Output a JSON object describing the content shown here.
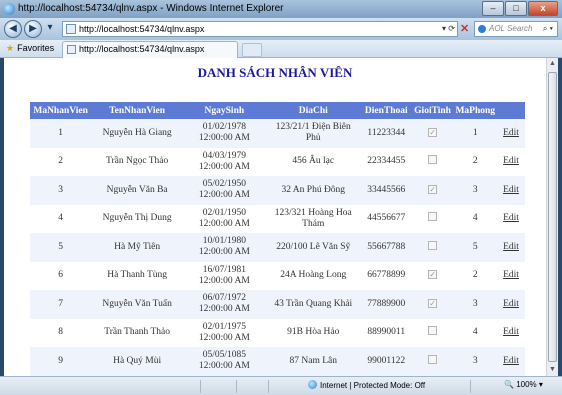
{
  "window": {
    "title": "http://localhost:54734/qlnv.aspx - Windows Internet Explorer",
    "address": "http://localhost:54734/qlnv.aspx",
    "search_placeholder": "AOL Search",
    "favorites_label": "Favorites",
    "tab_title": "http://localhost:54734/qlnv.aspx",
    "minimize": "–",
    "maximize": "□",
    "close": "x"
  },
  "page": {
    "title": "DANH SÁCH NHÂN VIÊN",
    "columns": [
      "MaNhanVien",
      "TenNhanVien",
      "NgaySinh",
      "DiaChi",
      "DienThoai",
      "GioiTinh",
      "MaPhong",
      ""
    ],
    "edit_label": "Edit",
    "rows": [
      {
        "ma": "1",
        "ten": "Nguyễn Hà Giang",
        "ngay": "01/02/1978 12:00:00 AM",
        "diachi": "123/21/1 Điện Biên Phủ",
        "dt": "11223344",
        "gt": true,
        "phong": "1"
      },
      {
        "ma": "2",
        "ten": "Trần Ngọc Thảo",
        "ngay": "04/03/1979 12:00:00 AM",
        "diachi": "456 Âu lạc",
        "dt": "22334455",
        "gt": false,
        "phong": "2"
      },
      {
        "ma": "3",
        "ten": "Nguyễn Văn Ba",
        "ngay": "05/02/1950 12:00:00 AM",
        "diachi": "32 An Phú Đông",
        "dt": "33445566",
        "gt": true,
        "phong": "3"
      },
      {
        "ma": "4",
        "ten": "Nguyễn Thị Dung",
        "ngay": "02/01/1950 12:00:00 AM",
        "diachi": "123/321 Hoàng Hoa Thám",
        "dt": "44556677",
        "gt": false,
        "phong": "4"
      },
      {
        "ma": "5",
        "ten": "Hà Mỹ Tiên",
        "ngay": "10/01/1980 12:00:00 AM",
        "diachi": "220/100 Lê Văn Sỹ",
        "dt": "55667788",
        "gt": false,
        "phong": "5"
      },
      {
        "ma": "6",
        "ten": "Hà Thanh Tùng",
        "ngay": "16/07/1981 12:00:00 AM",
        "diachi": "24A Hoàng Long",
        "dt": "66778899",
        "gt": true,
        "phong": "2"
      },
      {
        "ma": "7",
        "ten": "Nguyễn Văn Tuấn",
        "ngay": "06/07/1972 12:00:00 AM",
        "diachi": "43 Trần Quang Khải",
        "dt": "77889900",
        "gt": true,
        "phong": "3"
      },
      {
        "ma": "8",
        "ten": "Trần Thanh Thảo",
        "ngay": "02/01/1975 12:00:00 AM",
        "diachi": "91B Hòa Hảo",
        "dt": "88990011",
        "gt": false,
        "phong": "4"
      },
      {
        "ma": "9",
        "ten": "Hà Quý Mùi",
        "ngay": "05/05/1085 12:00:00 AM",
        "diachi": "87 Nam Lân",
        "dt": "99001122",
        "gt": false,
        "phong": "3"
      }
    ]
  },
  "status": {
    "zone": "Internet | Protected Mode: Off",
    "zoom": "100%"
  },
  "colors": {
    "header_bg": "#5d7bd5",
    "alt_row_bg": "#eff3fb",
    "title_color": "#1a1aa0"
  }
}
